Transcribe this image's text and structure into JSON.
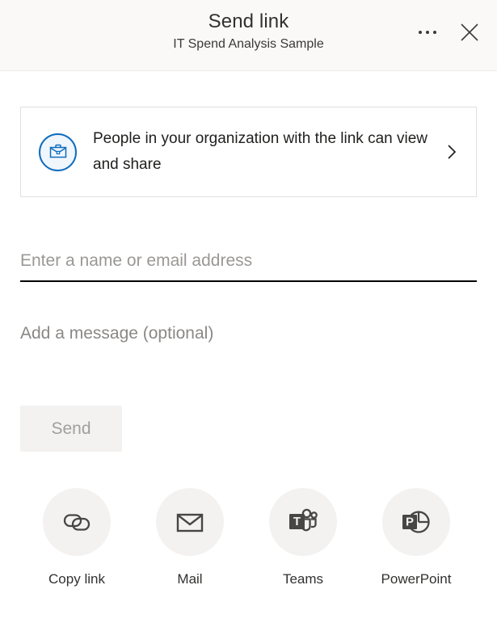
{
  "header": {
    "title": "Send link",
    "subtitle": "IT Spend Analysis Sample",
    "more_options_label": "More options",
    "close_label": "Close",
    "icons": {
      "more": "ellipsis-icon",
      "close": "close-icon"
    }
  },
  "permission": {
    "text": "People in your organization with the link can view and share",
    "icon": "briefcase-icon",
    "chevron": "chevron-right-icon",
    "accent_color": "#0f6cbd",
    "icon_background": "#eff6fc"
  },
  "recipients": {
    "placeholder": "Enter a name or email address",
    "value": ""
  },
  "message": {
    "placeholder": "Add a message (optional)",
    "value": ""
  },
  "send": {
    "label": "Send",
    "enabled": false,
    "background": "#f3f2f1",
    "text_color": "#a19f9d"
  },
  "share_actions": [
    {
      "label": "Copy link",
      "icon": "link-chain-icon"
    },
    {
      "label": "Mail",
      "icon": "envelope-icon"
    },
    {
      "label": "Teams",
      "icon": "microsoft-teams-icon"
    },
    {
      "label": "PowerPoint",
      "icon": "microsoft-powerpoint-icon"
    }
  ],
  "colors": {
    "header_background": "#faf9f8",
    "header_border": "#edebe9",
    "body_background": "#ffffff",
    "box_border": "#e1dfdd",
    "icon_dark": "#484644",
    "circle_background": "#f3f2f1"
  }
}
